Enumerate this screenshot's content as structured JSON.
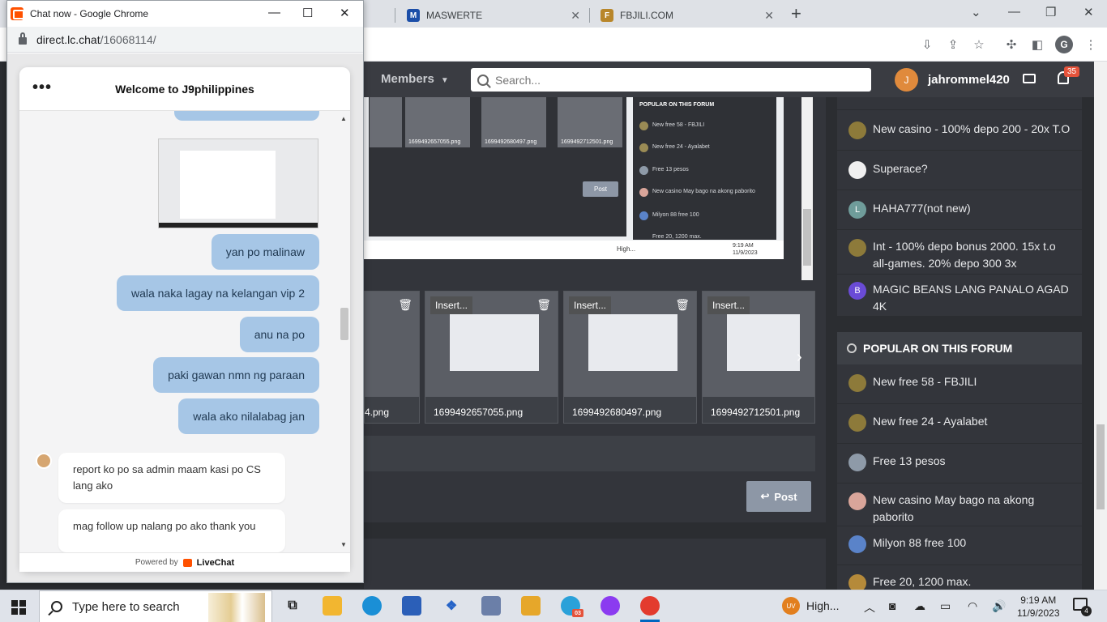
{
  "browser": {
    "tabs": [
      {
        "label": "MASWERTE"
      },
      {
        "label": "FBJILI.COM"
      }
    ],
    "new_tab": "+",
    "close_glyph": "✕",
    "profile_initial": "G"
  },
  "forum": {
    "nav_members": "Members",
    "search_placeholder": "Search...",
    "username": "jahrommel420",
    "user_initial": "J",
    "notification_count": "35",
    "sidebar_threads": [
      {
        "title": "New casino - 100% depo 200 - 20x T.O"
      },
      {
        "title": "Superace?"
      },
      {
        "title": "HAHA777(not new)",
        "initial": "L"
      },
      {
        "title": "Int - 100% depo bonus 2000. 15x t.o all-games. 20% depo 300 3x"
      },
      {
        "title": "MAGIC BEANS LANG PANALO AGAD 4K",
        "initial": "B"
      }
    ],
    "popular_title": "POPULAR ON THIS FORUM",
    "popular_threads": [
      {
        "title": "New free 58 - FBJILI"
      },
      {
        "title": "New free 24 - Ayalabet"
      },
      {
        "title": "Free 13 pesos"
      },
      {
        "title": "New casino May bago na akong paborito"
      },
      {
        "title": "Milyon 88 free 100"
      },
      {
        "title": "Free 20, 1200 max."
      }
    ],
    "attachments": [
      {
        "insert": "Insert...",
        "filename": "4.png"
      },
      {
        "insert": "Insert...",
        "filename": "1699492657055.png"
      },
      {
        "insert": "Insert...",
        "filename": "1699492680497.png"
      },
      {
        "insert": "Insert...",
        "filename": "1699492712501.png"
      }
    ],
    "post_label": "Post",
    "embedded": {
      "filenames": [
        "1699492657055.png",
        "1699492680497.png",
        "1699492712501.png"
      ],
      "post_label": "Post",
      "popular_title": "POPULAR ON THIS FORUM",
      "items": [
        "New free 58 - FBJILI",
        "New free 24 - Ayalabet",
        "Free 13 pesos",
        "New casino May bago na akong paborito",
        "Milyon 88 free 100",
        "Free 20, 1200 max."
      ],
      "tray_label": "High...",
      "clock_time": "9:19 AM",
      "clock_date": "11/9/2023"
    }
  },
  "chat_window": {
    "title": "Chat now - Google Chrome",
    "url_host": "direct.lc.chat",
    "url_path": "/16068114/",
    "header_title": "Welcome to J9philippines",
    "menu_glyph": "•••",
    "messages_out": [
      "yan po malinaw",
      "wala naka lagay na kelangan vip 2",
      "anu na po",
      "paki gawan nmn ng paraan",
      "wala ako nilalabag jan"
    ],
    "messages_in": [
      "report ko po sa admin maam kasi po CS lang ako",
      "mag follow up nalang po ako thank you"
    ],
    "powered_by": "Powered by",
    "brand": "LiveChat"
  },
  "taskbar": {
    "search_placeholder": "Type here to search",
    "tray_app_label": "High...",
    "clock_time": "9:19 AM",
    "clock_date": "11/9/2023",
    "notification_count": "4",
    "telegram_badge": "03"
  }
}
